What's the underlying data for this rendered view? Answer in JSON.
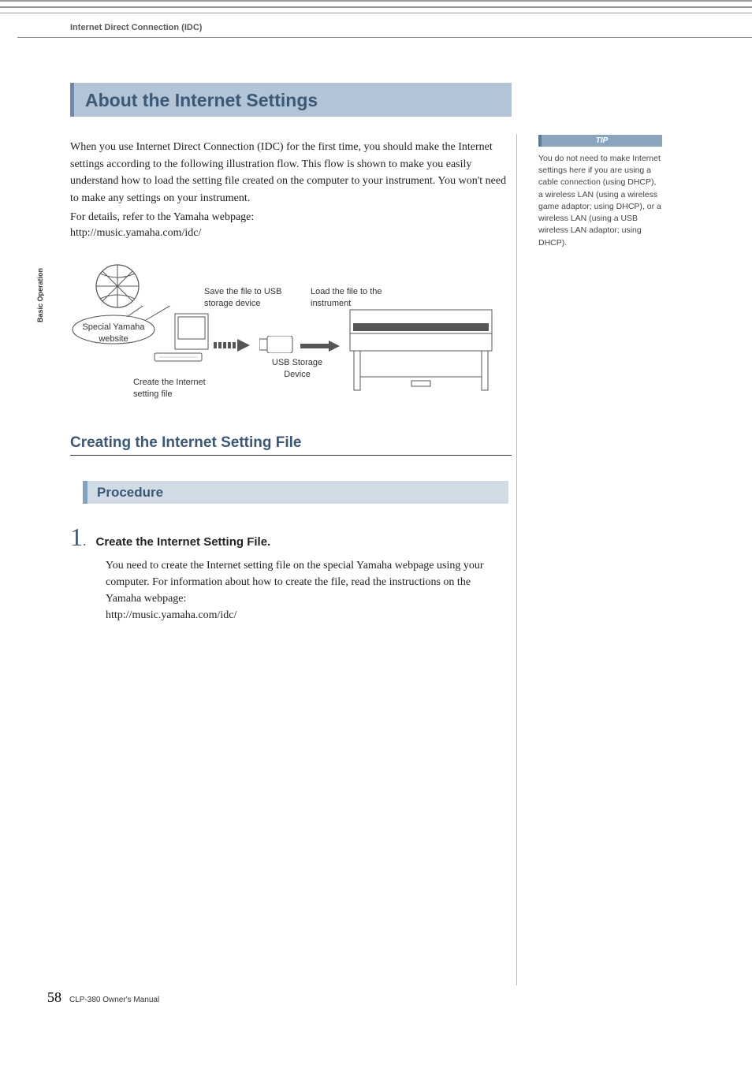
{
  "header": {
    "breadcrumb": "Internet Direct Connection (IDC)",
    "side_tab": "Basic Operation"
  },
  "title": "About the Internet Settings",
  "intro": "When you use Internet Direct Connection (IDC) for the first time, you should make the Internet settings according to the following illustration flow. This flow is shown to make you easily understand how to load the setting file created on the computer to your instrument. You won't need to make any settings on your instrument.",
  "details_line": "For details, refer to the Yamaha webpage:",
  "url": "http://music.yamaha.com/idc/",
  "diagram": {
    "website_label": "Special Yamaha website",
    "create_label": "Create the Internet setting file",
    "save_label": "Save the file to USB storage device",
    "load_label": "Load the file to the instrument",
    "usb_label": "USB Storage Device"
  },
  "subheading": "Creating the Internet Setting File",
  "procedure_label": "Procedure",
  "step": {
    "number": "1",
    "title": "Create the Internet Setting File.",
    "body": "You need to create the Internet setting file on the special Yamaha webpage using your computer. For information about how to create the file, read the instructions on the Yamaha webpage:",
    "url": "http://music.yamaha.com/idc/"
  },
  "tip": {
    "label": "TIP",
    "body": "You do not need to make Internet settings here if you are using a cable connection (using DHCP), a wireless LAN (using a wireless game adaptor; using DHCP), or a wireless LAN (using a USB wireless LAN adaptor; using DHCP)."
  },
  "footer": {
    "page": "58",
    "manual": "CLP-380 Owner's Manual"
  }
}
